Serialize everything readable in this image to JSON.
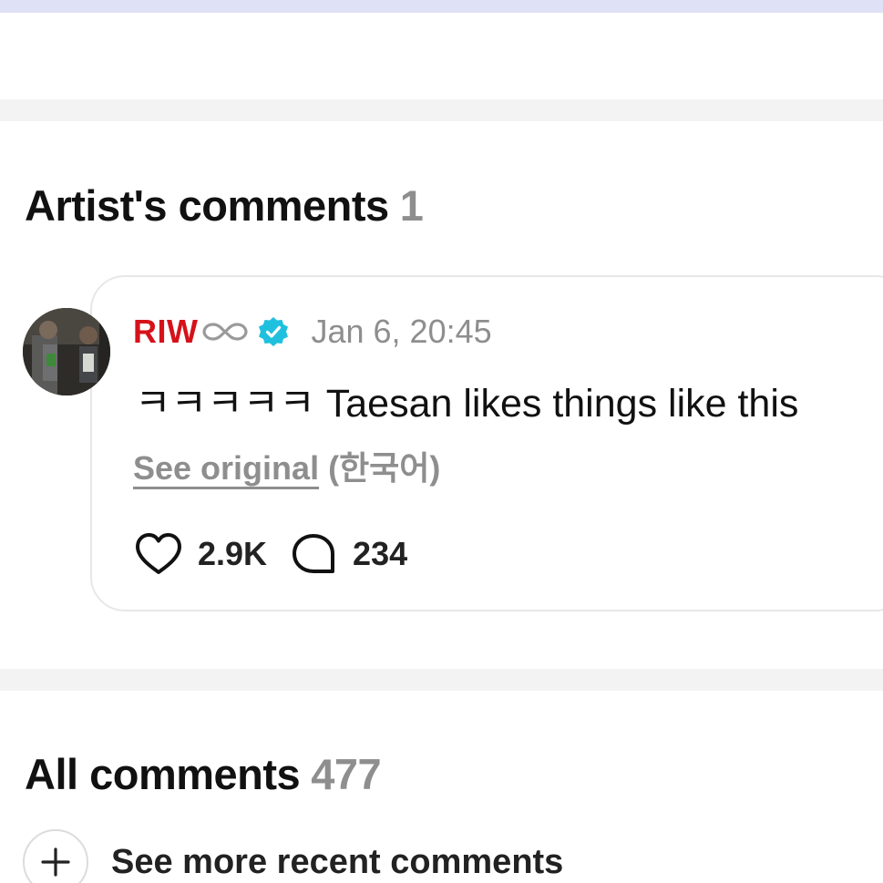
{
  "artist_comments": {
    "title": "Artist's comments",
    "count": "1",
    "comment": {
      "author": "RIW",
      "author_badge_icon": "infinity-icon",
      "verified_icon": "verified-icon",
      "timestamp": "Jan 6, 20:45",
      "text": "ㅋㅋㅋㅋㅋ Taesan likes things like this",
      "see_original_label": "See original",
      "original_language": "(한국어)",
      "likes": "2.9K",
      "replies": "234"
    }
  },
  "all_comments": {
    "title": "All comments",
    "count": "477",
    "see_more_label": "See more recent comments"
  },
  "colors": {
    "author": "#d5121b",
    "verified": "#1fc0de",
    "muted": "#8e8e8e",
    "divider": "#f3f3f3",
    "top_strip": "#dfe1f7"
  }
}
